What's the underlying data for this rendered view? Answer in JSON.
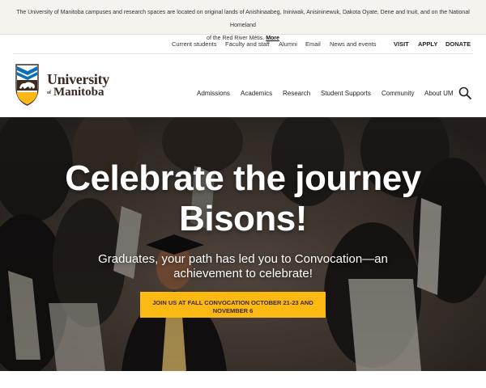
{
  "land_acknowledgement": {
    "text_line1": "The University of Manitoba campuses and research spaces are located on original lands of Anishinaabeg, Ininiwak, Anisininewuk, Dakota Oyate, Dene and Inuit, and on the National Homeland",
    "text_line2": "of the Red River Métis.",
    "more_link": "More"
  },
  "utility_nav": {
    "current_students": "Current students",
    "faculty_staff": "Faculty and staff",
    "alumni": "Alumni",
    "email": "Email",
    "news_events": "News and events",
    "visit": "VISIT",
    "apply": "APPLY",
    "donate": "DONATE"
  },
  "logo": {
    "word1": "University",
    "word_of": "of",
    "word2": "Manitoba"
  },
  "main_nav": {
    "admissions": "Admissions",
    "academics": "Academics",
    "research": "Research",
    "student_supports": "Student Supports",
    "community": "Community",
    "about": "About UM",
    "search_icon": "search-icon"
  },
  "hero": {
    "title_line1": "Celebrate the journey",
    "title_line2": "Bisons!",
    "subtitle_line1": "Graduates, your path has led you to Convocation—an",
    "subtitle_line2": "achievement to celebrate!",
    "cta_line1": "JOIN US AT FALL CONVOCATION OCTOBER 21-23 AND",
    "cta_line2": "NOVEMBER 6"
  },
  "colors": {
    "brand_brown": "#3a2a1f",
    "brand_gold": "#fdb913",
    "brand_blue": "#0a6fb4"
  }
}
